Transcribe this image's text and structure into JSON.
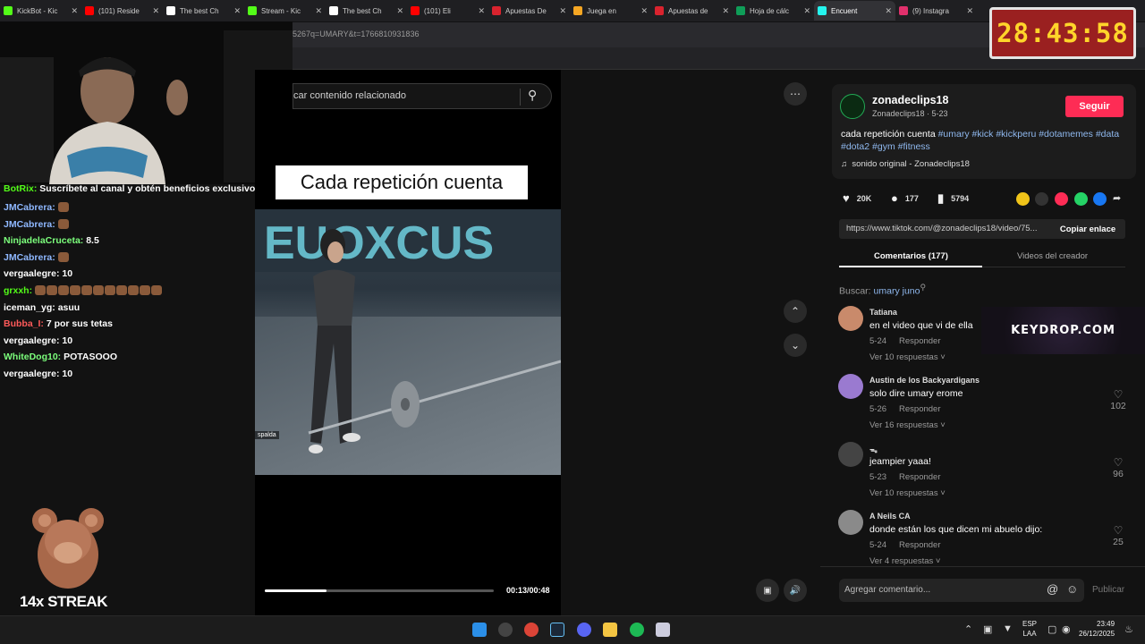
{
  "browser": {
    "tabs": [
      {
        "title": "KickBot - Kic",
        "color": "#53fc18"
      },
      {
        "title": "(101) Reside",
        "color": "#ff0000"
      },
      {
        "title": "The best Ch",
        "color": "#ffffff"
      },
      {
        "title": "Stream - Kic",
        "color": "#53fc18"
      },
      {
        "title": "The best Ch",
        "color": "#ffffff"
      },
      {
        "title": "(101) Eli",
        "color": "#ff0000"
      },
      {
        "title": "Apuestas De",
        "color": "#d9232e"
      },
      {
        "title": "Juega en",
        "color": "#f5a623"
      },
      {
        "title": "Apuestas de",
        "color": "#d9232e"
      },
      {
        "title": "Hoja de cálc",
        "color": "#0f9d58"
      },
      {
        "title": "Encuent",
        "color": "#25f4ee"
      },
      {
        "title": "(9) Instagra",
        "color": "#e1306c"
      }
    ],
    "url_fragment": "5267q=UMARY&t=1766810931836"
  },
  "stream_overlay": {
    "timer": "28:43:58",
    "streak_label": "14x STREAK",
    "chat": [
      {
        "user": "BotRix:",
        "color": "#53fc18",
        "message": "Suscríbete al canal y obtén beneficios exclusivos"
      },
      {
        "user": "JMCabrera:",
        "color": "#8fb8ff",
        "message": ""
      },
      {
        "user": "JMCabrera:",
        "color": "#8fb8ff",
        "message": ""
      },
      {
        "user": "NinjadelaCruceta:",
        "color": "#7cff7c",
        "message": "8.5"
      },
      {
        "user": "JMCabrera:",
        "color": "#8fb8ff",
        "message": ""
      },
      {
        "user": "vergaalegre:",
        "color": "#ffffff",
        "message": "10"
      },
      {
        "user": "grxxh:",
        "color": "#53fc18",
        "message": ""
      },
      {
        "user": "iceman_yg:",
        "color": "#ffffff",
        "message": "asuu"
      },
      {
        "user": "Bubba_I:",
        "color": "#ff5a5a",
        "message": "7 por sus tetas"
      },
      {
        "user": "vergaalegre:",
        "color": "#ffffff",
        "message": "10"
      },
      {
        "user": "WhiteDog10:",
        "color": "#7cff7c",
        "message": "POTASOOO"
      },
      {
        "user": "vergaalegre:",
        "color": "#ffffff",
        "message": "10"
      }
    ]
  },
  "video": {
    "search_placeholder": "car contenido relacionado",
    "caption": "Cada repetición cuenta",
    "subtitle_chip": "spalda",
    "time": "00:13/00:48",
    "progress_fraction": 0.27
  },
  "post": {
    "username": "zonadeclips18",
    "user_line": "Zonadeclips18 · 5-23",
    "follow_label": "Seguir",
    "description": "cada repetición cuenta",
    "hashtags": "#umary #kick #kickperu #dotamemes #data #dota2 #gym #fitness",
    "music": "sonido original - Zonadeclips18",
    "likes": "20K",
    "comments_count": "177",
    "saves": "5794",
    "link": "https://www.tiktok.com/@zonadeclips18/video/75...",
    "copy_label": "Copiar enlace",
    "tab_comments": "Comentarios (177)",
    "tab_creator": "Videos del creador",
    "search_prefix": "Buscar:",
    "search_term": "umary juno",
    "ad_text": "KEYDROP.COM",
    "comment_placeholder": "Agregar comentario...",
    "publish_label": "Publicar"
  },
  "comments": [
    {
      "name": "Tatiana",
      "text": "en el video que vi de ella",
      "date": "5-24",
      "reply": "Responder",
      "replies": "Ver 10 respuestas",
      "likes": "",
      "avatar": "#c98a6b"
    },
    {
      "name": "Austin de los Backyardigans",
      "text": "solo dire umary erome",
      "date": "5-26",
      "reply": "Responder",
      "replies": "Ver 16 respuestas",
      "likes": "102",
      "avatar": "#9a7ad0"
    },
    {
      "name": "ᯓ",
      "text": "jeampier yaaa!",
      "date": "5-23",
      "reply": "Responder",
      "replies": "Ver 10 respuestas",
      "likes": "96",
      "avatar": "#444444"
    },
    {
      "name": "A Neils CA",
      "text": "donde están los que dicen mi abuelo dijo:",
      "date": "5-24",
      "reply": "Responder",
      "replies": "Ver 4 respuestas",
      "likes": "25",
      "avatar": "#8a8a8a"
    }
  ],
  "taskbar": {
    "lang_top": "ESP",
    "lang_bottom": "LAA",
    "time": "23:49",
    "date": "26/12/2025"
  }
}
